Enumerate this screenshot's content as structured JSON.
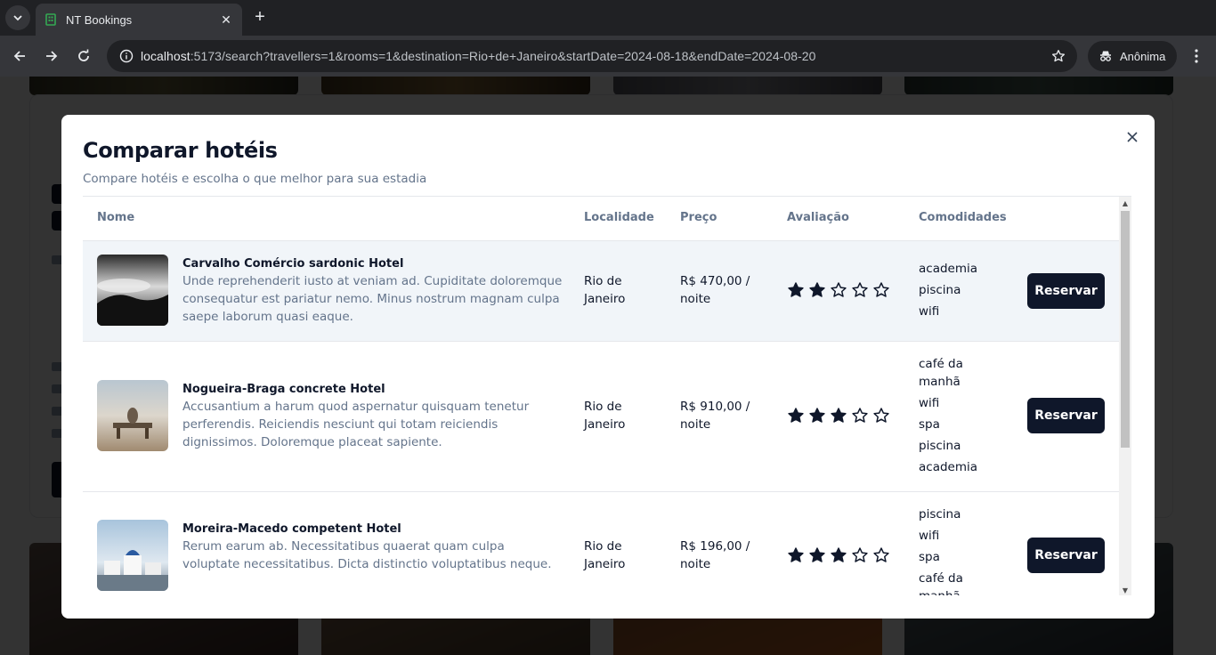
{
  "browser": {
    "tab_title": "NT Bookings",
    "url_host": "localhost",
    "url_rest": ":5173/search?travellers=1&rooms=1&destination=Rio+de+Janeiro&startDate=2024-08-18&endDate=2024-08-20",
    "profile_label": "Anônima"
  },
  "dialog": {
    "title": "Comparar hotéis",
    "subtitle": "Compare hotéis e escolha o que melhor para sua estadia",
    "close_label": "×",
    "columns": {
      "name": "Nome",
      "location": "Localidade",
      "price": "Preço",
      "rating": "Avaliação",
      "amenities": "Comodidades"
    },
    "hotels": [
      {
        "name": "Carvalho Comércio sardonic Hotel",
        "description": "Unde reprehenderit iusto at veniam ad. Cupiditate doloremque consequatur est pariatur nemo. Minus nostrum magnam culpa saepe laborum quasi eaque.",
        "location": "Rio de Janeiro",
        "price": "R$ 470,00 / noite",
        "rating": 2,
        "amenities": [
          "academia",
          "piscina",
          "wifi"
        ],
        "button": "Reservar"
      },
      {
        "name": "Nogueira-Braga concrete Hotel",
        "description": "Accusantium a harum quod aspernatur quisquam tenetur perferendis. Reiciendis nesciunt qui totam reiciendis dignissimos. Doloremque placeat sapiente.",
        "location": "Rio de Janeiro",
        "price": "R$ 910,00 / noite",
        "rating": 3,
        "amenities": [
          "café da manhã",
          "wifi",
          "spa",
          "piscina",
          "academia"
        ],
        "button": "Reservar"
      },
      {
        "name": "Moreira-Macedo competent Hotel",
        "description": "Rerum earum ab. Necessitatibus quaerat quam culpa voluptate necessitatibus. Dicta distinctio voluptatibus neque.",
        "location": "Rio de Janeiro",
        "price": "R$ 196,00 / noite",
        "rating": 3,
        "amenities": [
          "piscina",
          "wifi",
          "spa",
          "café da manhã"
        ],
        "button": "Reservar"
      }
    ]
  },
  "icons": {
    "favicon": "hotel-favicon-icon",
    "star_filled": "star-filled-icon",
    "star_empty": "star-outline-icon"
  },
  "colors": {
    "primary": "#0f172a",
    "muted_text": "#64748b",
    "row_highlight": "#f1f5f9",
    "favicon_green": "#34a853"
  }
}
